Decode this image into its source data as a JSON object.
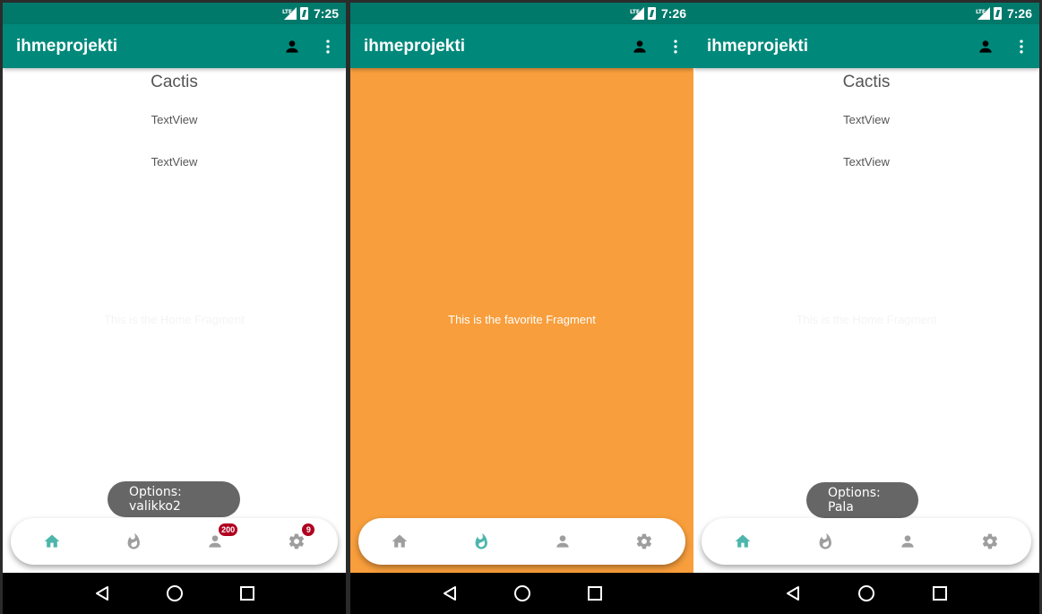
{
  "colors": {
    "status_bar": "#00796b",
    "app_bar": "#00897b",
    "accent_active": "#4db6ac",
    "icon_inactive": "#9e9e9e",
    "badge": "#b00020",
    "favorite_bg": "#f89e3c",
    "toast_bg": "#666666"
  },
  "screens": [
    {
      "status": {
        "network": "LTE",
        "time": "7:25"
      },
      "app_title": "ihmeprojekti",
      "content": {
        "heading": "Cactis",
        "text_view_1": "TextView",
        "text_view_2": "TextView",
        "fragment_text": "This is the Home Fragment"
      },
      "toast": "Options: valikko2",
      "bottom_nav": {
        "active": "home",
        "items": [
          {
            "id": "home",
            "icon": "home-icon",
            "badge": ""
          },
          {
            "id": "favorite",
            "icon": "flame-icon",
            "badge": ""
          },
          {
            "id": "profile",
            "icon": "person-icon",
            "badge": "200"
          },
          {
            "id": "settings",
            "icon": "gear-icon",
            "badge": "9"
          }
        ]
      }
    },
    {
      "status": {
        "network": "LTE",
        "time": "7:26"
      },
      "app_title": "ihmeprojekti",
      "content": {
        "fragment_text": "This is the favorite Fragment"
      },
      "toast": "",
      "bottom_nav": {
        "active": "favorite",
        "items": [
          {
            "id": "home",
            "icon": "home-icon",
            "badge": ""
          },
          {
            "id": "favorite",
            "icon": "flame-icon",
            "badge": ""
          },
          {
            "id": "profile",
            "icon": "person-icon",
            "badge": ""
          },
          {
            "id": "settings",
            "icon": "gear-icon",
            "badge": ""
          }
        ]
      }
    },
    {
      "status": {
        "network": "LTE",
        "time": "7:26"
      },
      "app_title": "ihmeprojekti",
      "content": {
        "heading": "Cactis",
        "text_view_1": "TextView",
        "text_view_2": "TextView",
        "fragment_text": "This is the Home Fragment"
      },
      "toast": "Options: Pala",
      "bottom_nav": {
        "active": "home",
        "items": [
          {
            "id": "home",
            "icon": "home-icon",
            "badge": ""
          },
          {
            "id": "favorite",
            "icon": "flame-icon",
            "badge": ""
          },
          {
            "id": "profile",
            "icon": "person-icon",
            "badge": ""
          },
          {
            "id": "settings",
            "icon": "gear-icon",
            "badge": ""
          }
        ]
      }
    }
  ]
}
